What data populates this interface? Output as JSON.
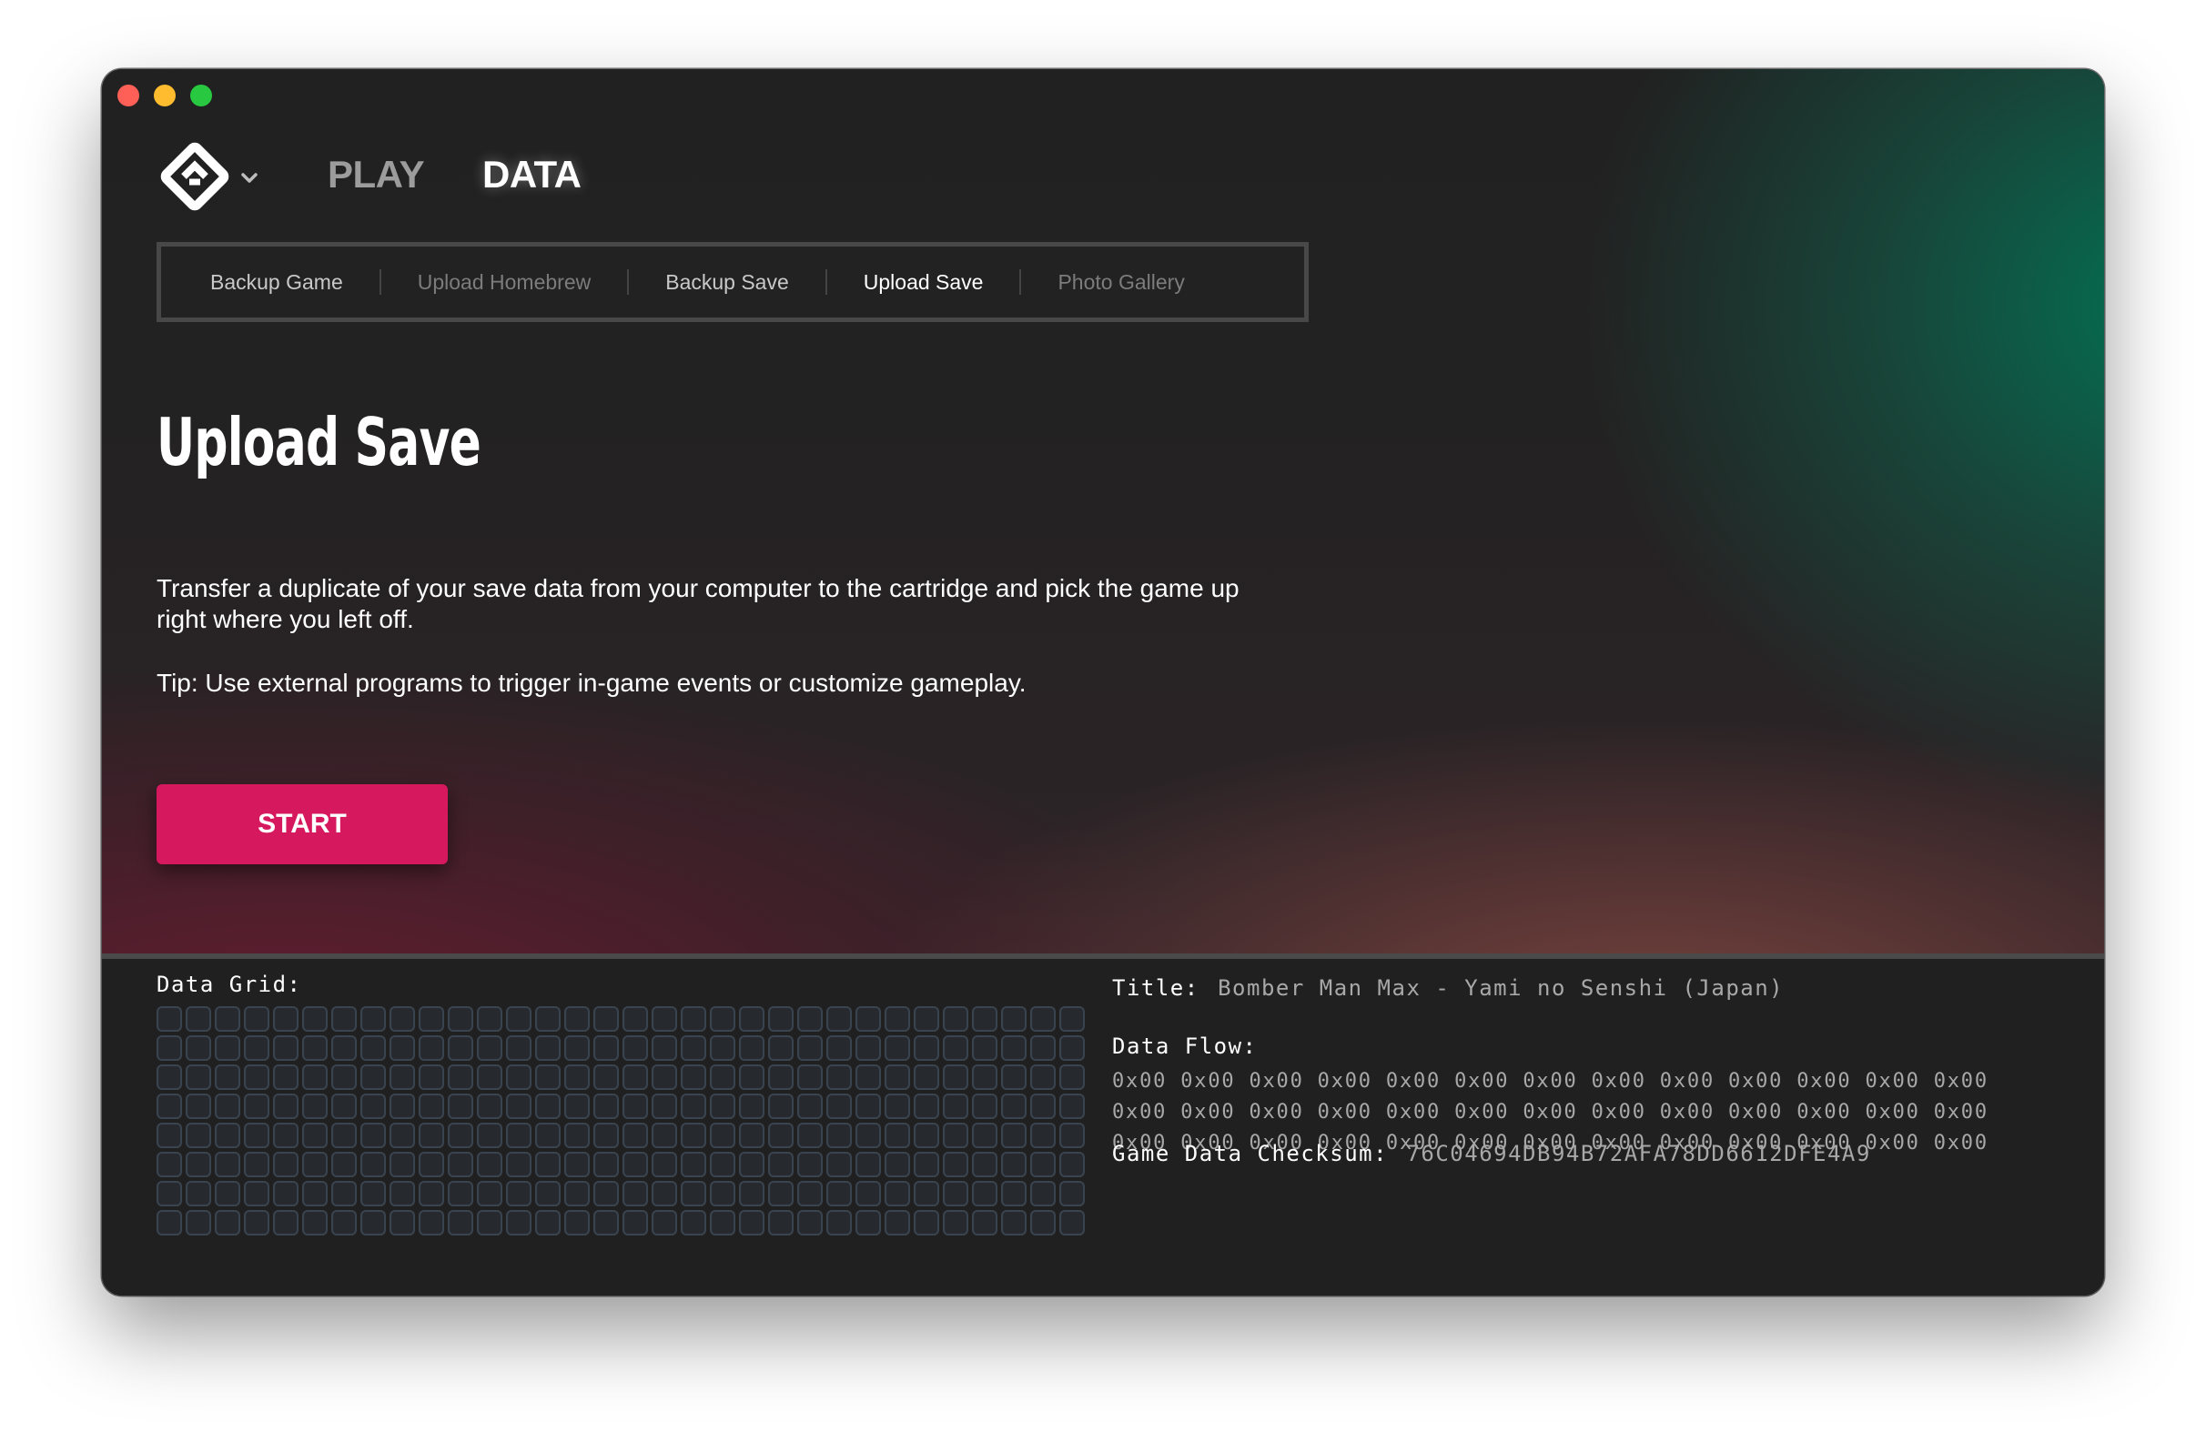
{
  "nav": {
    "play_label": "PLAY",
    "data_label": "DATA"
  },
  "tabs": [
    {
      "label": "Backup Game",
      "state": "normal"
    },
    {
      "label": "Upload Homebrew",
      "state": "disabled"
    },
    {
      "label": "Backup Save",
      "state": "normal"
    },
    {
      "label": "Upload Save",
      "state": "active"
    },
    {
      "label": "Photo Gallery",
      "state": "disabled"
    }
  ],
  "main": {
    "title": "Upload Save",
    "description": "Transfer a duplicate of your save data from your computer to the cartridge and pick the game up right where you left off.",
    "tip": "Tip: Use external programs to trigger in-game events or customize gameplay.",
    "start_label": "START"
  },
  "data_panel": {
    "grid_label": "Data Grid:",
    "grid_columns": 32,
    "grid_rows": 8,
    "title_label": "Title:",
    "title_value": "Bomber Man Max - Yami no Senshi (Japan)",
    "flow_label": "Data Flow:",
    "flow_rows": [
      "0x00 0x00 0x00 0x00 0x00 0x00 0x00 0x00 0x00 0x00 0x00 0x00 0x00",
      "0x00 0x00 0x00 0x00 0x00 0x00 0x00 0x00 0x00 0x00 0x00 0x00 0x00",
      "0x00 0x00 0x00 0x00 0x00 0x00 0x00 0x00 0x00 0x00 0x00 0x00 0x00"
    ],
    "checksum_label": "Game Data Checksum:",
    "checksum_value": "76C04694DB94B72AFA78DD6612DFE4A9"
  },
  "colors": {
    "accent": "#d6185e",
    "window_bg": "#202020",
    "grid_cell_border": "#3a4450"
  },
  "icons": {
    "logo": "diamond-logo-icon",
    "logo_menu": "chevron-down-icon"
  }
}
